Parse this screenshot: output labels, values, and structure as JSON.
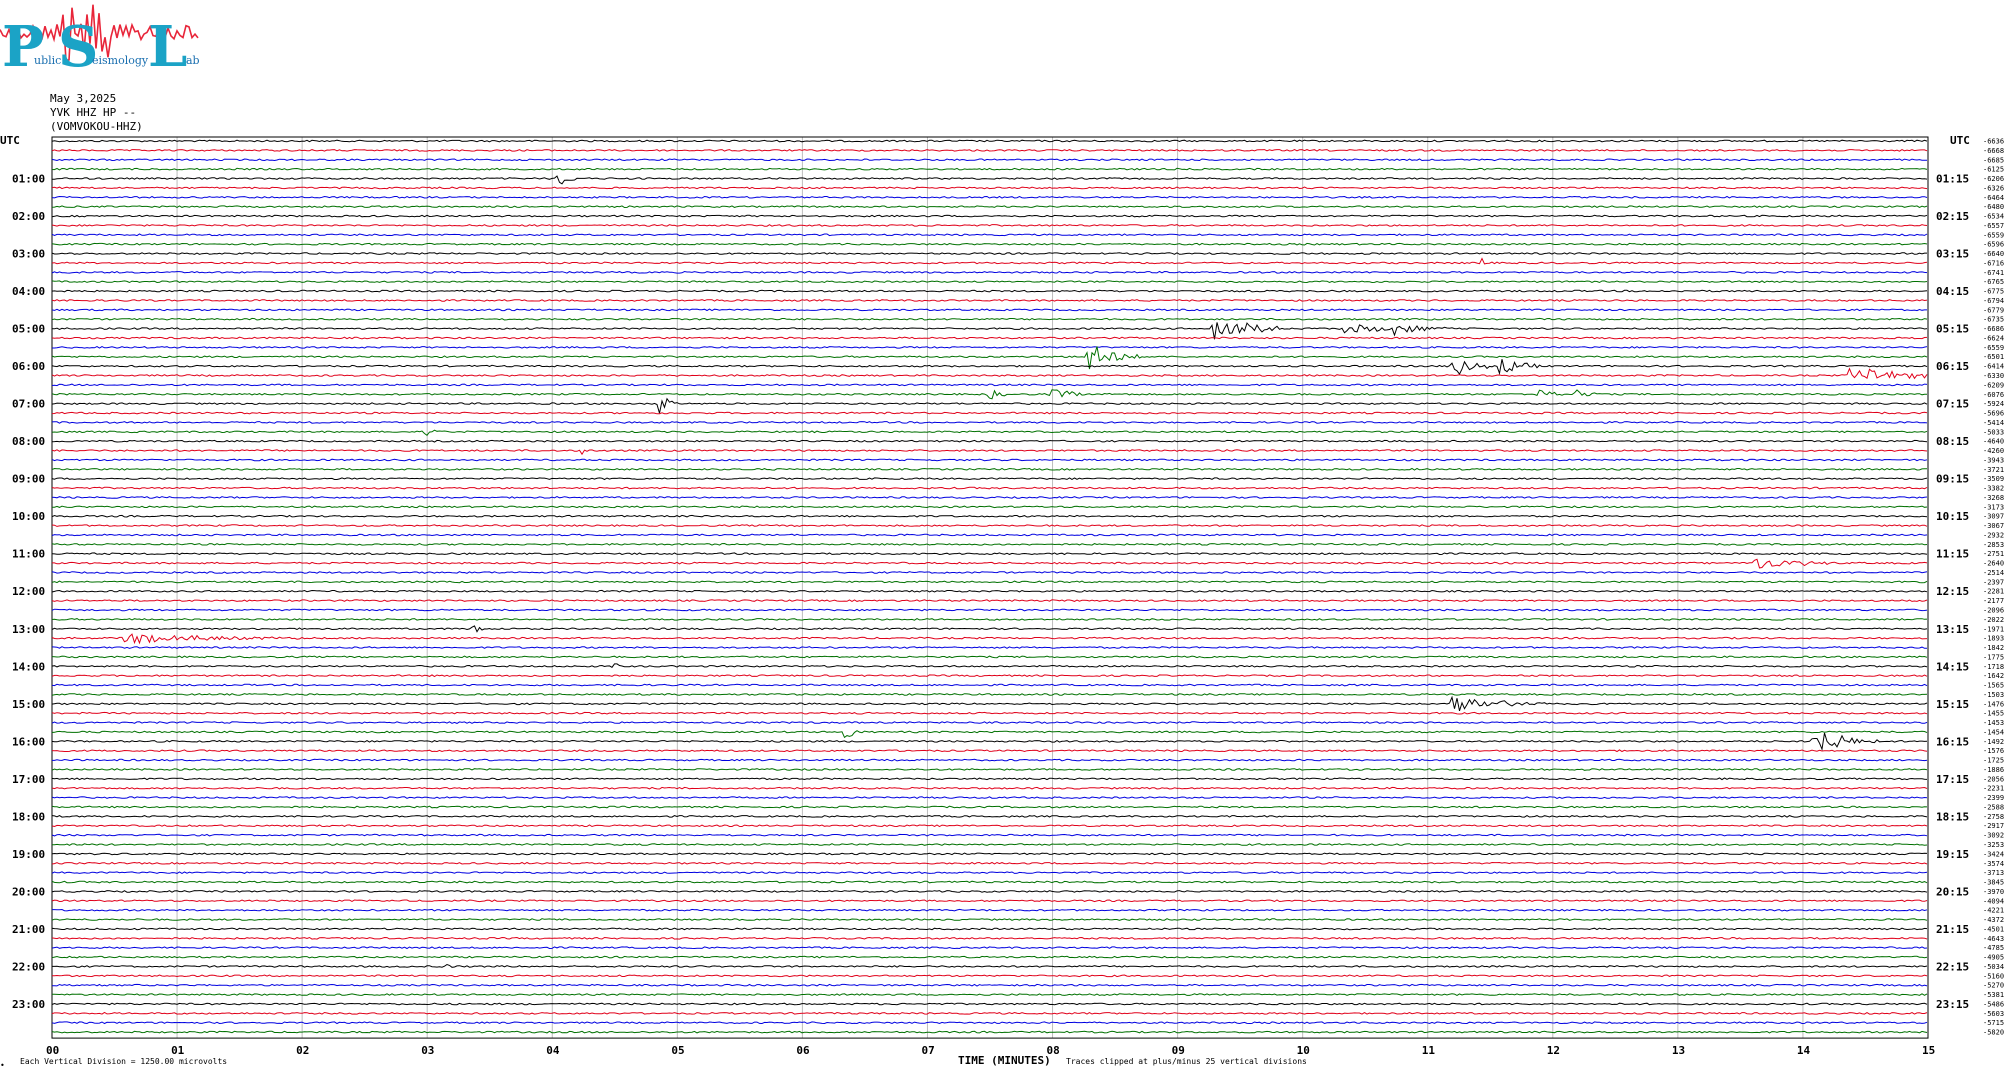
{
  "logo": {
    "letters": [
      "P",
      "S",
      "L"
    ],
    "words": [
      "ublic",
      "eismology",
      "ab"
    ],
    "waveform_color": "#e8263a",
    "letter_color": "#1ba3c6"
  },
  "header": {
    "date": "May 3,2025",
    "station": "YVK HHZ HP --",
    "channel": "(VOMVOKOU-HHZ)"
  },
  "left_labels": [
    "UTC",
    "01:00",
    "02:00",
    "03:00",
    "04:00",
    "05:00",
    "06:00",
    "07:00",
    "08:00",
    "09:00",
    "10:00",
    "11:00",
    "12:00",
    "13:00",
    "14:00",
    "15:00",
    "16:00",
    "17:00",
    "18:00",
    "19:00",
    "20:00",
    "21:00",
    "22:00",
    "23:00"
  ],
  "right_labels": [
    "UTC",
    "01:15",
    "02:15",
    "03:15",
    "04:15",
    "05:15",
    "06:15",
    "07:15",
    "08:15",
    "09:15",
    "10:15",
    "11:15",
    "12:15",
    "13:15",
    "14:15",
    "15:15",
    "16:15",
    "17:15",
    "18:15",
    "19:15",
    "20:15",
    "21:15",
    "22:15",
    "23:15"
  ],
  "trace_offsets": [
    "-6636",
    "-6668",
    "-6685",
    "-6125",
    "-6206",
    "-6326",
    "-6464",
    "-6480",
    "-6534",
    "-6557",
    "-6559",
    "-6596",
    "-6640",
    "-6716",
    "-6741",
    "-6765",
    "-6775",
    "-6794",
    "-6779",
    "-6735",
    "-6686",
    "-6624",
    "-6559",
    "-6501",
    "-6414",
    "-6330",
    "-6209",
    "-6076",
    "-5924",
    "-5696",
    "-5414",
    "-5033",
    "-4640",
    "-4260",
    "-3943",
    "-3721",
    "-3509",
    "-3382",
    "-3268",
    "-3173",
    "-3097",
    "-3067",
    "-2932",
    "-2853",
    "-2751",
    "-2640",
    "-2514",
    "-2397",
    "-2281",
    "-2177",
    "-2096",
    "-2022",
    "-1971",
    "-1893",
    "-1842",
    "-1775",
    "-1718",
    "-1642",
    "-1565",
    "-1503",
    "-1476",
    "-1455",
    "-1453",
    "-1454",
    "-1492",
    "-1576",
    "-1725",
    "-1886",
    "-2056",
    "-2231",
    "-2399",
    "-2588",
    "-2758",
    "-2917",
    "-3092",
    "-3253",
    "-3424",
    "-3574",
    "-3713",
    "-3845",
    "-3970",
    "-4094",
    "-4221",
    "-4372",
    "-4501",
    "-4643",
    "-4785",
    "-4905",
    "-5034",
    "-5160",
    "-5270",
    "-5381",
    "-5486",
    "-5603",
    "-5715",
    "-5820"
  ],
  "trace_colors": [
    "#000000",
    "#e0001a",
    "#0000e0",
    "#007000"
  ],
  "events": [
    {
      "trace": 4,
      "minute": 4.05,
      "amp": 1.0,
      "dur": 0.15
    },
    {
      "trace": 13,
      "minute": 11.45,
      "amp": 0.7,
      "dur": 0.03
    },
    {
      "trace": 20,
      "minute": 9.3,
      "amp": 1.8,
      "dur": 0.5
    },
    {
      "trace": 20,
      "minute": 10.35,
      "amp": 0.6,
      "dur": 0.6
    },
    {
      "trace": 20,
      "minute": 10.75,
      "amp": 0.7,
      "dur": 0.4
    },
    {
      "trace": 23,
      "minute": 8.3,
      "amp": 1.5,
      "dur": 0.4
    },
    {
      "trace": 24,
      "minute": 11.2,
      "amp": 1.2,
      "dur": 0.3
    },
    {
      "trace": 24,
      "minute": 11.6,
      "amp": 1.0,
      "dur": 0.3
    },
    {
      "trace": 25,
      "minute": 14.4,
      "amp": 1.0,
      "dur": 0.8
    },
    {
      "trace": 27,
      "minute": 7.5,
      "amp": 0.6,
      "dur": 0.15
    },
    {
      "trace": 27,
      "minute": 8.0,
      "amp": 0.5,
      "dur": 0.5
    },
    {
      "trace": 27,
      "minute": 11.9,
      "amp": 0.5,
      "dur": 0.2
    },
    {
      "trace": 27,
      "minute": 12.2,
      "amp": 0.5,
      "dur": 0.2
    },
    {
      "trace": 28,
      "minute": 4.85,
      "amp": 1.4,
      "dur": 0.2
    },
    {
      "trace": 31,
      "minute": 3.0,
      "amp": 0.5,
      "dur": 0.2
    },
    {
      "trace": 33,
      "minute": 4.25,
      "amp": 0.4,
      "dur": 0.1
    },
    {
      "trace": 45,
      "minute": 13.6,
      "amp": 0.7,
      "dur": 0.7
    },
    {
      "trace": 52,
      "minute": 3.35,
      "amp": 0.5,
      "dur": 0.2
    },
    {
      "trace": 53,
      "minute": 0.6,
      "amp": 0.5,
      "dur": 1.5
    },
    {
      "trace": 56,
      "minute": 4.5,
      "amp": 0.3,
      "dur": 0.1
    },
    {
      "trace": 60,
      "minute": 11.2,
      "amp": 1.0,
      "dur": 0.8
    },
    {
      "trace": 63,
      "minute": 6.35,
      "amp": 0.7,
      "dur": 0.2
    },
    {
      "trace": 64,
      "minute": 14.1,
      "amp": 1.5,
      "dur": 0.5
    },
    {
      "trace": 88,
      "minute": 3.15,
      "amp": 0.5,
      "dur": 0.1
    }
  ],
  "chart_data": {
    "type": "line",
    "xlabel": "TIME (MINUTES)",
    "xticks": [
      "00",
      "01",
      "02",
      "03",
      "04",
      "05",
      "06",
      "07",
      "08",
      "09",
      "10",
      "11",
      "12",
      "13",
      "14",
      "15"
    ],
    "xlim": [
      0,
      15
    ],
    "traces_per_hour": 4,
    "trace_count": 96,
    "grid": true
  },
  "footer": {
    "scale": "Each Vertical Division = 1250.00 microvolts",
    "clip_note": "Traces clipped at plus/minus 25 vertical divisions",
    "corner_mark": "•"
  }
}
